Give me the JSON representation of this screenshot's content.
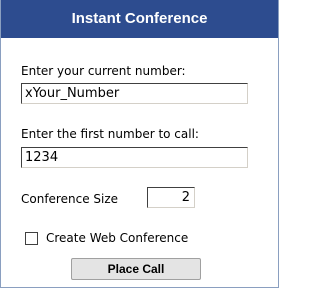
{
  "header": {
    "title": "Instant Conference"
  },
  "current_number": {
    "label": "Enter your current number:",
    "value": "xYour_Number"
  },
  "first_call": {
    "label": "Enter the first number to call:",
    "value": "1234"
  },
  "conference_size": {
    "label": "Conference Size",
    "value": "2"
  },
  "web_conference": {
    "label": "Create Web Conference",
    "checked": false
  },
  "place_call": {
    "label": "Place Call"
  },
  "colors": {
    "header_bg": "#2d4c8f",
    "header_text": "#ffffff",
    "border": "#8a9fc0"
  }
}
